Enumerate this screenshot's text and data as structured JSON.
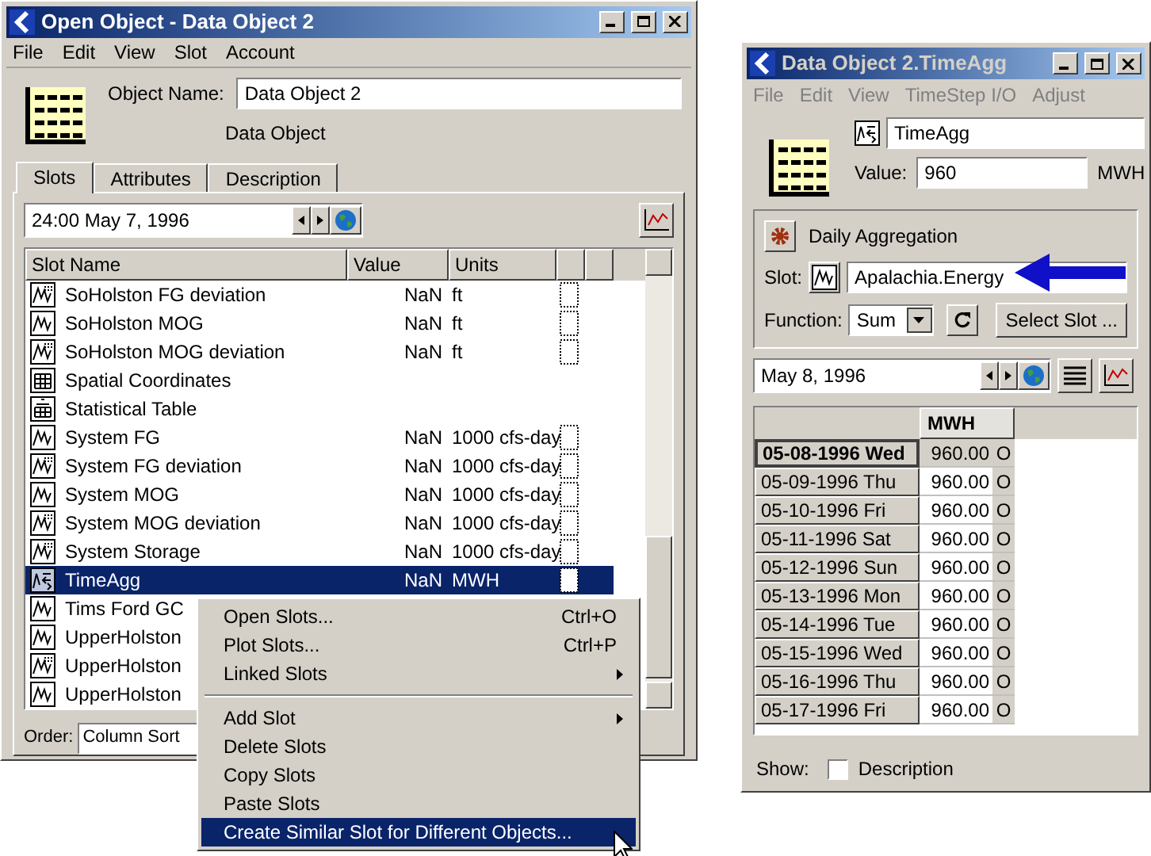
{
  "open_object_window": {
    "title": "Open Object - Data Object 2",
    "menu": [
      "File",
      "Edit",
      "View",
      "Slot",
      "Account"
    ],
    "object_name_label": "Object Name:",
    "object_name": "Data Object 2",
    "object_type": "Data Object",
    "tabs": [
      {
        "label": "Slots",
        "selected": true
      },
      {
        "label": "Attributes",
        "selected": false
      },
      {
        "label": "Description",
        "selected": false
      }
    ],
    "date": "24:00 May 7, 1996",
    "slots_table": {
      "columns": [
        "Slot Name",
        "Value",
        "Units"
      ],
      "rows": [
        {
          "kind": "deviation",
          "name": "SoHolston FG deviation",
          "value": "NaN",
          "units": "ft",
          "selected": false
        },
        {
          "kind": "series",
          "name": "SoHolston MOG",
          "value": "NaN",
          "units": "ft",
          "selected": false
        },
        {
          "kind": "deviation",
          "name": "SoHolston MOG deviation",
          "value": "NaN",
          "units": "ft",
          "selected": false
        },
        {
          "kind": "table",
          "name": "Spatial Coordinates",
          "selected": false
        },
        {
          "kind": "stats",
          "name": "Statistical Table",
          "selected": false
        },
        {
          "kind": "series",
          "name": "System FG",
          "value": "NaN",
          "units": "1000 cfs-day",
          "selected": false
        },
        {
          "kind": "deviation",
          "name": "System FG deviation",
          "value": "NaN",
          "units": "1000 cfs-day",
          "selected": false
        },
        {
          "kind": "series",
          "name": "System MOG",
          "value": "NaN",
          "units": "1000 cfs-day",
          "selected": false
        },
        {
          "kind": "deviation",
          "name": "System MOG deviation",
          "value": "NaN",
          "units": "1000 cfs-day",
          "selected": false
        },
        {
          "kind": "deviation",
          "name": "System Storage",
          "value": "NaN",
          "units": "1000 cfs-day",
          "selected": false
        },
        {
          "kind": "agg",
          "name": "TimeAgg",
          "value": "NaN",
          "units": "MWH",
          "selected": true
        },
        {
          "kind": "series",
          "name": "Tims Ford GC",
          "selected": false
        },
        {
          "kind": "series",
          "name": "UpperHolston",
          "selected": false
        },
        {
          "kind": "deviation",
          "name": "UpperHolston",
          "selected": false
        },
        {
          "kind": "series",
          "name": "UpperHolston",
          "selected": false
        }
      ]
    },
    "order_label": "Order:",
    "order_value": "Column Sort"
  },
  "context_menu": [
    {
      "kind": "item",
      "label": "Open Slots...",
      "shortcut": "Ctrl+O",
      "submenu": false,
      "selected": false
    },
    {
      "kind": "item",
      "label": "Plot Slots...",
      "shortcut": "Ctrl+P",
      "submenu": false,
      "selected": false
    },
    {
      "kind": "item",
      "label": "Linked Slots",
      "submenu": true,
      "selected": false
    },
    {
      "kind": "separator"
    },
    {
      "kind": "item",
      "label": "Add Slot",
      "submenu": true,
      "selected": false
    },
    {
      "kind": "item",
      "label": "Delete Slots",
      "submenu": false,
      "selected": false
    },
    {
      "kind": "item",
      "label": "Copy Slots",
      "submenu": false,
      "selected": false
    },
    {
      "kind": "item",
      "label": "Paste Slots",
      "submenu": false,
      "selected": false
    },
    {
      "kind": "item",
      "label": "Create Similar Slot for Different Objects...",
      "submenu": false,
      "selected": true
    }
  ],
  "slot_window": {
    "title": "Data Object 2.TimeAgg",
    "menu": [
      {
        "label": "File",
        "disabled": true
      },
      {
        "label": "Edit",
        "disabled": true
      },
      {
        "label": "View",
        "disabled": true
      },
      {
        "label": "TimeStep I/O",
        "disabled": true
      },
      {
        "label": "Adjust",
        "disabled": true
      }
    ],
    "slot_name": "TimeAgg",
    "value_label": "Value:",
    "value": "960",
    "value_units": "MWH",
    "method": "Daily Aggregation",
    "slot_label": "Slot:",
    "slot": "Apalachia.Energy",
    "function_label": "Function:",
    "function": "Sum",
    "select_slot": "Select Slot ...",
    "date": "May 8, 1996",
    "series_table": {
      "columns": [
        "MWH"
      ],
      "rows": [
        {
          "date": "05-08-1996 Wed",
          "value": "960.00",
          "flag": "O",
          "selected": true
        },
        {
          "date": "05-09-1996 Thu",
          "value": "960.00",
          "flag": "O",
          "selected": false
        },
        {
          "date": "05-10-1996 Fri",
          "value": "960.00",
          "flag": "O",
          "selected": false
        },
        {
          "date": "05-11-1996 Sat",
          "value": "960.00",
          "flag": "O",
          "selected": false
        },
        {
          "date": "05-12-1996 Sun",
          "value": "960.00",
          "flag": "O",
          "selected": false
        },
        {
          "date": "05-13-1996 Mon",
          "value": "960.00",
          "flag": "O",
          "selected": false
        },
        {
          "date": "05-14-1996 Tue",
          "value": "960.00",
          "flag": "O",
          "selected": false
        },
        {
          "date": "05-15-1996 Wed",
          "value": "960.00",
          "flag": "O",
          "selected": false
        },
        {
          "date": "05-16-1996 Thu",
          "value": "960.00",
          "flag": "O",
          "selected": false
        },
        {
          "date": "05-17-1996 Fri",
          "value": "960.00",
          "flag": "O",
          "selected": false
        }
      ]
    },
    "show_label": "Show:",
    "description_option": {
      "label": "Description",
      "checked": false
    }
  }
}
